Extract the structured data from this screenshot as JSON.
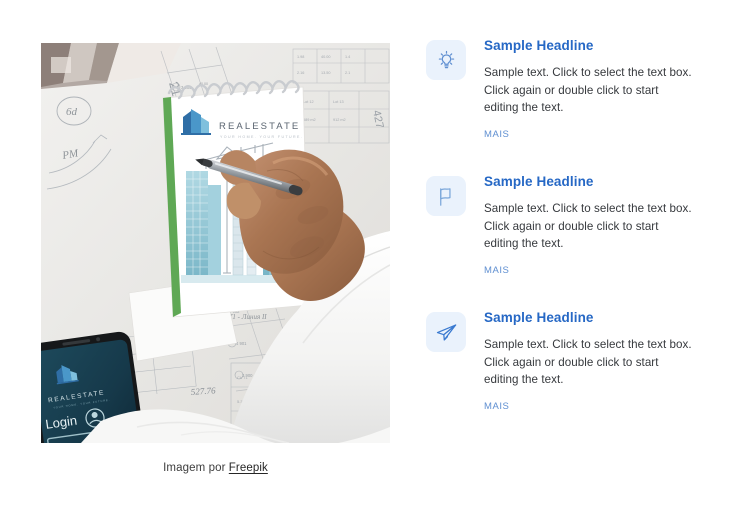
{
  "page": {
    "background_color": "#ffffff",
    "accent_color": "#2668c5",
    "icon_badge_color": "#eaf2fc",
    "link_color": "#5f8fd1"
  },
  "photo": {
    "alt": "Architect hand drawing skyscraper sketch on notepad over blueprints with smartphone",
    "brand_text": "REALESTATE",
    "brand_subtext": "YOUR HOME. YOUR FUTURE.",
    "phone_brand_text": "REALESTATE",
    "phone_login_label": "Login",
    "blueprint_labels": [
      "6d",
      "PM",
      "21",
      "427",
      "527.76"
    ]
  },
  "caption": {
    "prefix": "Imagem por ",
    "credit": "Freepik"
  },
  "features": [
    {
      "icon": "lightbulb-icon",
      "title": "Sample Headline",
      "text": "Sample text. Click to select the text box. Click again or double click to start editing the text.",
      "more_label": "MAIS"
    },
    {
      "icon": "flag-icon",
      "title": "Sample Headline",
      "text": "Sample text. Click to select the text box. Click again or double click to start editing the text.",
      "more_label": "MAIS"
    },
    {
      "icon": "paper-plane-icon",
      "title": "Sample Headline",
      "text": "Sample text. Click to select the text box. Click again or double click to start editing the text.",
      "more_label": "MAIS"
    }
  ]
}
